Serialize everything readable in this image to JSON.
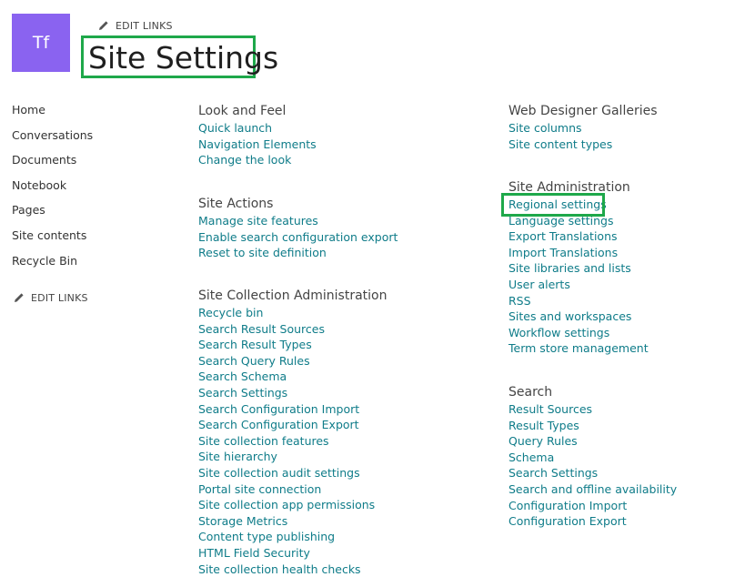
{
  "site": {
    "logo_initials": "Tf"
  },
  "header": {
    "edit_links": "EDIT LINKS",
    "title": "Site Settings"
  },
  "quick_launch": {
    "items": [
      "Home",
      "Conversations",
      "Documents",
      "Notebook",
      "Pages",
      "Site contents",
      "Recycle Bin"
    ],
    "edit_links": "EDIT LINKS"
  },
  "sections": {
    "look_and_feel": {
      "heading": "Look and Feel",
      "links": [
        "Quick launch",
        "Navigation Elements",
        "Change the look"
      ]
    },
    "site_actions": {
      "heading": "Site Actions",
      "links": [
        "Manage site features",
        "Enable search configuration export",
        "Reset to site definition"
      ]
    },
    "site_collection_administration": {
      "heading": "Site Collection Administration",
      "links": [
        "Recycle bin",
        "Search Result Sources",
        "Search Result Types",
        "Search Query Rules",
        "Search Schema",
        "Search Settings",
        "Search Configuration Import",
        "Search Configuration Export",
        "Site collection features",
        "Site hierarchy",
        "Site collection audit settings",
        "Portal site connection",
        "Site collection app permissions",
        "Storage Metrics",
        "Content type publishing",
        "HTML Field Security",
        "Site collection health checks"
      ]
    },
    "web_designer_galleries": {
      "heading": "Web Designer Galleries",
      "links": [
        "Site columns",
        "Site content types"
      ]
    },
    "site_administration": {
      "heading": "Site Administration",
      "links": [
        "Regional settings",
        "Language settings",
        "Export Translations",
        "Import Translations",
        "Site libraries and lists",
        "User alerts",
        "RSS",
        "Sites and workspaces",
        "Workflow settings",
        "Term store management"
      ]
    },
    "search": {
      "heading": "Search",
      "links": [
        "Result Sources",
        "Result Types",
        "Query Rules",
        "Schema",
        "Search Settings",
        "Search and offline availability",
        "Configuration Import",
        "Configuration Export"
      ]
    }
  },
  "colors": {
    "link": "#0f7c89",
    "logo_background": "#8a63f0",
    "highlight_border": "#1ea84a",
    "text": "#333333"
  },
  "icons": {
    "edit": "pencil-icon"
  }
}
